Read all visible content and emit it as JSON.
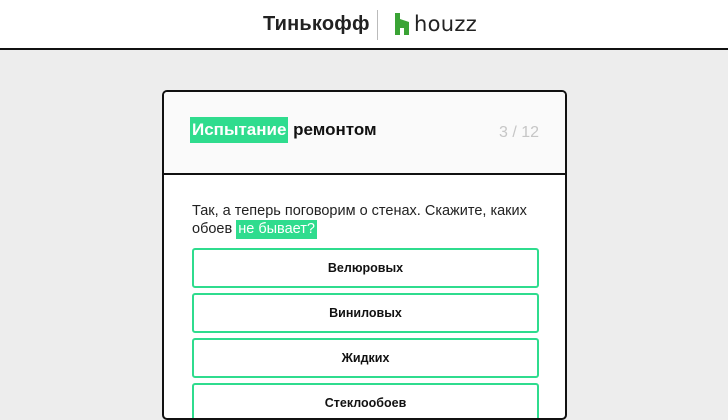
{
  "header": {
    "brand_left": "Тинькофф",
    "brand_right": "houzz"
  },
  "card": {
    "title_highlight": "Испытание",
    "title_rest": "ремонтом",
    "progress": "3 / 12",
    "question_text": "Так, а теперь поговорим о стенах. Скажите, каких обоев",
    "question_highlight": "не бывает?",
    "options": [
      {
        "label": "Велюровых"
      },
      {
        "label": "Виниловых"
      },
      {
        "label": "Жидких"
      },
      {
        "label": "Стеклообоев"
      }
    ]
  },
  "colors": {
    "accent": "#2fdc8e",
    "background": "#ededed",
    "progress_text": "#c6c6c6"
  },
  "icons": {
    "houzz_logo": "houzz-logo-icon"
  }
}
